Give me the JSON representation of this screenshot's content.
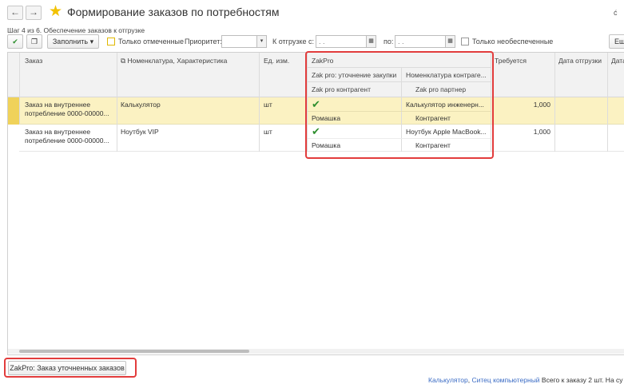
{
  "window": {
    "title": "Формирование заказов по потребностям",
    "step": "Шаг 4 из 6. Обеспечение заказов к отгрузке",
    "right_glyph": "ć",
    "back_glyph": "←",
    "forward_glyph": "→",
    "star_glyph": "★"
  },
  "toolbar": {
    "check_glyph": "✔",
    "copy_glyph": "❐",
    "fill_label": "Заполнить",
    "fill_caret": "▾",
    "only_marked": "Только отмеченные",
    "priority_label": "Приоритет:",
    "priority_value": "",
    "dropdown_glyph": "▾",
    "ship_from_label": "К отгрузке с:",
    "ship_from_value": " .  .",
    "calendar_glyph": "▦",
    "to_label": "по:",
    "to_value": " .  .",
    "only_unprovided": "Только необеспеченные",
    "more_label": "Ещ"
  },
  "table": {
    "headers": {
      "order": "Заказ",
      "nomenclature": "Номенклатура, Характеристика",
      "unit": "Ед. изм.",
      "zakpro": "ZakPro",
      "zp_refine": "Zak pro: уточнение закупки",
      "zp_nomen": "Номенклатура контраге...",
      "zp_counterparty": "Zak pro контрагент",
      "zp_partner": "Zak pro партнер",
      "required": "Требуется",
      "ship_date": "Дата отгрузки",
      "date_trunc": "Дата"
    },
    "nomen_icon": "⧉",
    "rows": [
      {
        "order_line1": "Заказ на внутреннее",
        "order_line2": "потребление 0000-00000...",
        "nomenclature": "Калькулятор",
        "unit": "шт",
        "refine_mark": "✔",
        "zp_nomen": "Калькулятор инженерн...",
        "zp_counterparty": "Ромашка",
        "zp_partner": "Контрагент",
        "required": "1,000"
      },
      {
        "order_line1": "Заказ на внутреннее",
        "order_line2": "потребление 0000-00000...",
        "nomenclature": "Ноутбук VIP",
        "unit": "шт",
        "refine_mark": "✔",
        "zp_nomen": "Ноутбук Apple MacBook...",
        "zp_counterparty": "Ромашка",
        "zp_partner": "Контрагент",
        "required": "1,000"
      }
    ]
  },
  "bottom": {
    "zakpro_button": "ZakPro: Заказ уточненных заказов"
  },
  "footer": {
    "link1": "Калькулятор",
    "sep": ", ",
    "link2": "Ситец компьютерный",
    "text": " Всего к заказу 2 шт. На су"
  },
  "colors": {
    "selected_row": "#fbf2c2",
    "highlight": "#e23c3c",
    "star": "#f2c200",
    "check": "#2f8f2f",
    "link": "#3a6bc4"
  }
}
